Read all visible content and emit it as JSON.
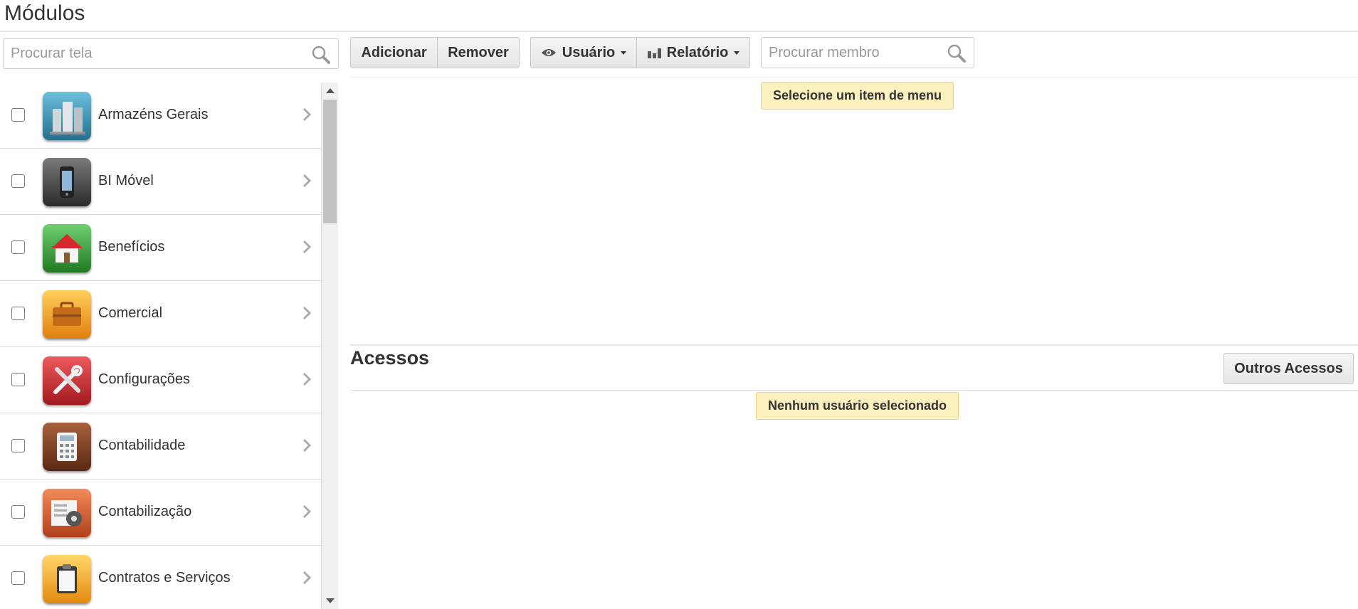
{
  "page": {
    "title": "Módulos"
  },
  "left_search": {
    "placeholder": "Procurar tela"
  },
  "modules": [
    {
      "label": "Armazéns Gerais",
      "icon": "warehouse-icon",
      "color": "#3a8fb0"
    },
    {
      "label": "BI Móvel",
      "icon": "mobile-phone-icon",
      "color": "#444444"
    },
    {
      "label": "Benefícios",
      "icon": "house-icon",
      "color": "#3f9b3f"
    },
    {
      "label": "Comercial",
      "icon": "briefcase-icon",
      "color": "#f0a020"
    },
    {
      "label": "Configurações",
      "icon": "tools-icon",
      "color": "#c8282d"
    },
    {
      "label": "Contabilidade",
      "icon": "calculator-icon",
      "color": "#7a3b22"
    },
    {
      "label": "Contabilização",
      "icon": "gear-icon",
      "color": "#d8602d"
    },
    {
      "label": "Contratos e Serviços",
      "icon": "clipboard-icon",
      "color": "#f3a820"
    }
  ],
  "toolbar": {
    "add_label": "Adicionar",
    "remove_label": "Remover",
    "user_label": "Usuário",
    "report_label": "Relatório",
    "member_search_placeholder": "Procurar membro"
  },
  "alerts": {
    "menu": "Selecione um item de menu",
    "user": "Nenhum usuário selecionado"
  },
  "access": {
    "title": "Acessos",
    "other_label": "Outros Acessos"
  }
}
